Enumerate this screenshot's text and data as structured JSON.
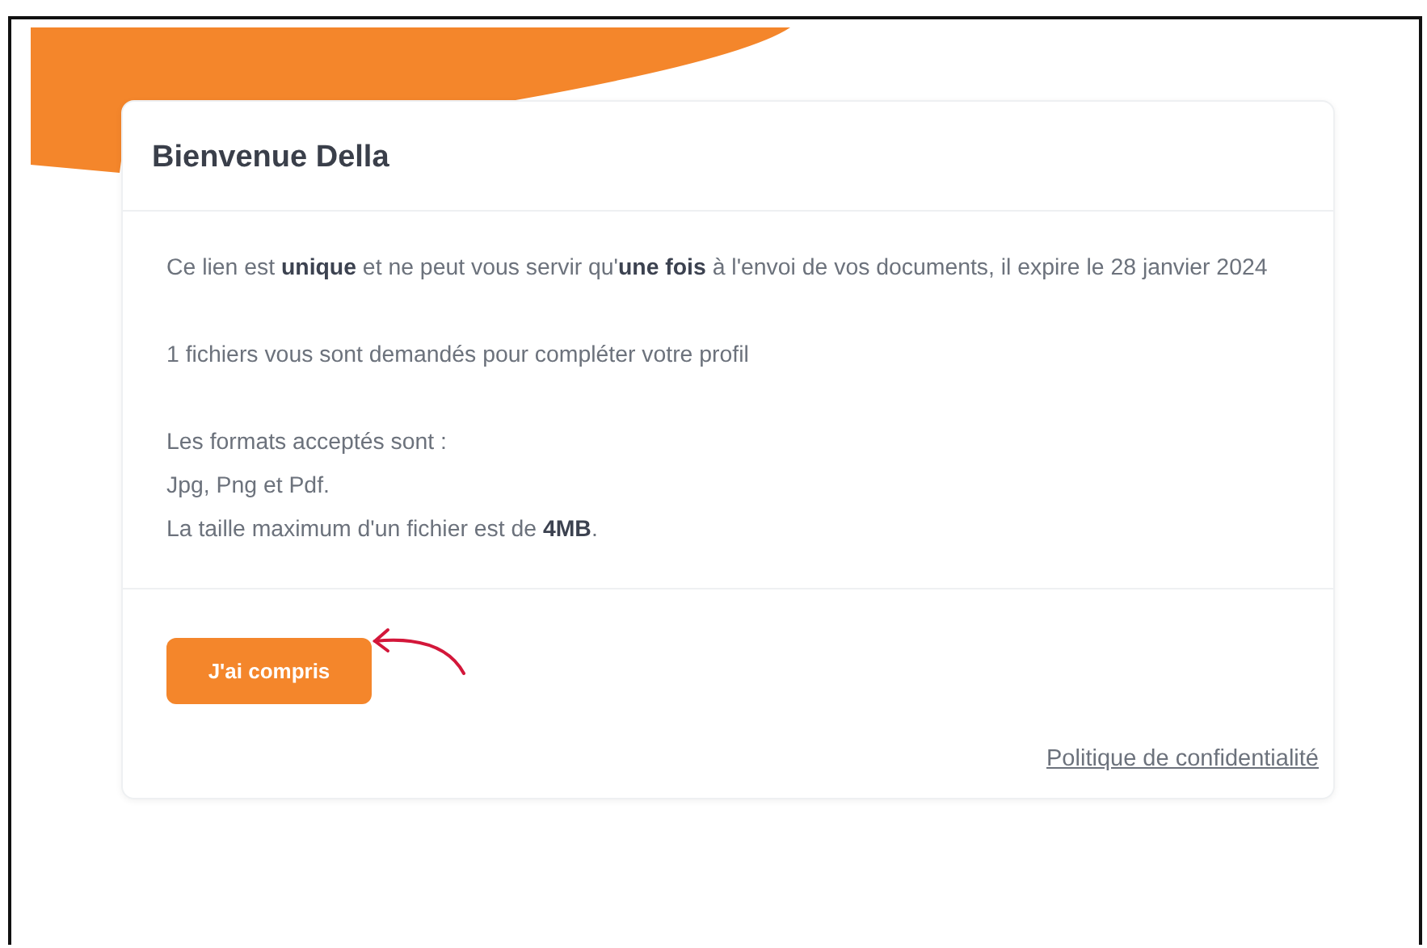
{
  "card": {
    "title": "Bienvenue Della",
    "paragraphs": [
      [
        "Ce lien est **unique** et ne peut vous servir qu'**une fois** à l'envoi de vos documents, il expire le 28 janvier 2024"
      ],
      [
        "1 fichiers vous sont demandés pour compléter votre profil"
      ],
      [
        "Les formats acceptés sont :",
        "Jpg, Png et Pdf.",
        "La taille maximum d'un fichier est de **4MB**."
      ]
    ],
    "button": "J'ai compris",
    "link": "Politique de confidentialité"
  }
}
